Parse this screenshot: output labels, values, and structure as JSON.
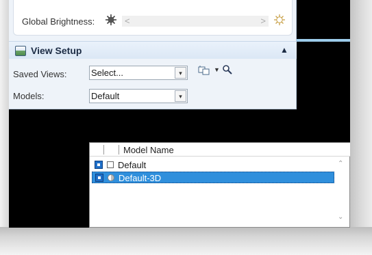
{
  "brightness": {
    "label": "Global Brightness:",
    "left_arrow": "<",
    "right_arrow": ">"
  },
  "view_setup": {
    "title": "View Setup",
    "collapse_glyph": "^",
    "saved_views_label": "Saved Views:",
    "saved_views_value": "Select...",
    "models_label": "Models:",
    "models_value": "Default",
    "caret": "▾"
  },
  "model_list": {
    "column_header": "Model Name",
    "rows": [
      {
        "name": "Default",
        "selected": false
      },
      {
        "name": "Default-3D",
        "selected": true
      }
    ]
  },
  "colors": {
    "selection": "#2f8fdc",
    "header_accent": "#9ccbea"
  }
}
